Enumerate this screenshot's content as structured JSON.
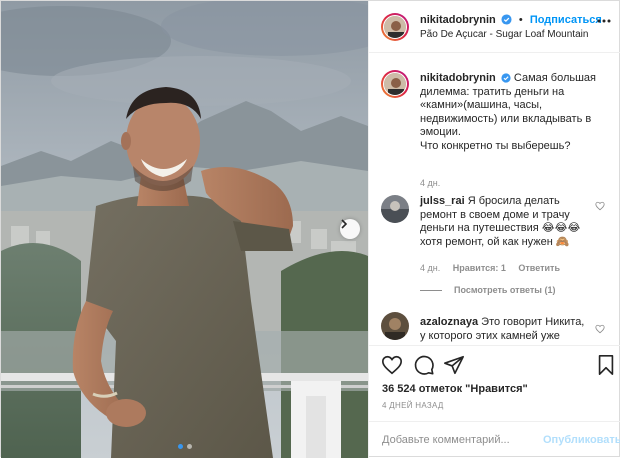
{
  "post": {
    "author": "nikitadobrynin",
    "follow_label": "Подписаться",
    "follow_separator": "•",
    "location": "Pão De Açucar - Sugar Loaf Mountain",
    "caption_lines": [
      "Самая большая",
      "дилемма: тратить деньги на",
      "«камни»(машина, часы,",
      "недвижимость) или вкладывать в",
      "эмоции.",
      "Что конкретно ты выберешь?"
    ],
    "caption_time": "4 дн.",
    "carousel": {
      "slides": 2,
      "active": 0
    }
  },
  "comments": [
    {
      "user": "julss_rai",
      "lines": [
        "Я бросила делать",
        "ремонт в своем доме и трачу",
        "деньги на путешествия 😂😂😂",
        "хотя ремонт, ой как нужен 🙈"
      ],
      "time": "4 дн.",
      "likes": "Нравится: 1",
      "reply_label": "Ответить",
      "view_replies": "Посмотреть ответы (1)"
    },
    {
      "user": "azaloznaya",
      "lines": [
        "Это говорит Никита,",
        "у которого этих камней уже"
      ]
    }
  ],
  "actions": {
    "likes_count": "36 524",
    "likes_suffix": "отметок \"Нравится\"",
    "date": "4 ДНЕЙ НАЗАД"
  },
  "add_comment": {
    "placeholder": "Добавьте комментарий...",
    "post_label": "Опубликовать"
  },
  "icons": {
    "heart": "heart-icon",
    "comment": "comment-bubble-icon",
    "share": "paper-plane-icon",
    "save": "bookmark-icon",
    "verified": "verified-badge-icon",
    "next": "chevron-right-icon"
  },
  "colors": {
    "accent": "#0095f6",
    "verified": "#3897f0",
    "muted": "#8e8e8e",
    "post_disabled": "#b2dffc"
  }
}
